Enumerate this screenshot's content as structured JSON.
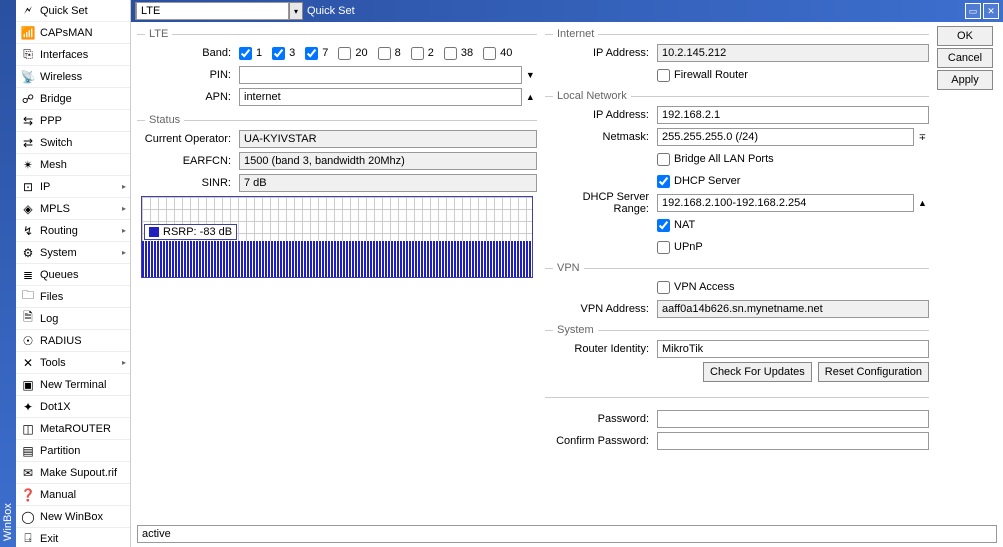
{
  "app_name": "WinBox",
  "sidebar": {
    "items": [
      {
        "label": "Quick Set",
        "icon": "🗲",
        "arrow": false
      },
      {
        "label": "CAPsMAN",
        "icon": "📶",
        "arrow": false
      },
      {
        "label": "Interfaces",
        "icon": "⎘",
        "arrow": false
      },
      {
        "label": "Wireless",
        "icon": "📡",
        "arrow": false
      },
      {
        "label": "Bridge",
        "icon": "☍",
        "arrow": false
      },
      {
        "label": "PPP",
        "icon": "⇆",
        "arrow": false
      },
      {
        "label": "Switch",
        "icon": "⇄",
        "arrow": false
      },
      {
        "label": "Mesh",
        "icon": "✴",
        "arrow": false
      },
      {
        "label": "IP",
        "icon": "⊡",
        "arrow": true
      },
      {
        "label": "MPLS",
        "icon": "◈",
        "arrow": true
      },
      {
        "label": "Routing",
        "icon": "↯",
        "arrow": true
      },
      {
        "label": "System",
        "icon": "⚙",
        "arrow": true
      },
      {
        "label": "Queues",
        "icon": "≣",
        "arrow": false
      },
      {
        "label": "Files",
        "icon": "🗀",
        "arrow": false
      },
      {
        "label": "Log",
        "icon": "🗎",
        "arrow": false
      },
      {
        "label": "RADIUS",
        "icon": "☉",
        "arrow": false
      },
      {
        "label": "Tools",
        "icon": "✕",
        "arrow": true
      },
      {
        "label": "New Terminal",
        "icon": "▣",
        "arrow": false
      },
      {
        "label": "Dot1X",
        "icon": "✦",
        "arrow": false
      },
      {
        "label": "MetaROUTER",
        "icon": "◫",
        "arrow": false
      },
      {
        "label": "Partition",
        "icon": "▤",
        "arrow": false
      },
      {
        "label": "Make Supout.rif",
        "icon": "✉",
        "arrow": false
      },
      {
        "label": "Manual",
        "icon": "❓",
        "arrow": false
      },
      {
        "label": "New WinBox",
        "icon": "◯",
        "arrow": false
      },
      {
        "label": "Exit",
        "icon": "⍈",
        "arrow": false
      }
    ]
  },
  "titlebar": {
    "mode": "LTE",
    "title": "Quick Set"
  },
  "lte": {
    "group_label": "LTE",
    "band_label": "Band:",
    "bands": [
      {
        "num": "1",
        "checked": true
      },
      {
        "num": "3",
        "checked": true
      },
      {
        "num": "7",
        "checked": true
      },
      {
        "num": "20",
        "checked": false
      },
      {
        "num": "8",
        "checked": false
      },
      {
        "num": "2",
        "checked": false
      },
      {
        "num": "38",
        "checked": false
      },
      {
        "num": "40",
        "checked": false
      }
    ],
    "pin_label": "PIN:",
    "pin_value": "",
    "apn_label": "APN:",
    "apn_value": "internet"
  },
  "status": {
    "group_label": "Status",
    "operator_label": "Current Operator:",
    "operator_value": "UA-KYIVSTAR",
    "earfcn_label": "EARFCN:",
    "earfcn_value": "1500 (band 3, bandwidth 20Mhz)",
    "sinr_label": "SINR:",
    "sinr_value": "7 dB",
    "graph_label": "RSRP:  -83 dB",
    "status_text": "active"
  },
  "internet": {
    "group_label": "Internet",
    "ip_label": "IP Address:",
    "ip_value": "10.2.145.212",
    "fw_label": "Firewall Router"
  },
  "lan": {
    "group_label": "Local Network",
    "ip_label": "IP Address:",
    "ip_value": "192.168.2.1",
    "netmask_label": "Netmask:",
    "netmask_value": "255.255.255.0 (/24)",
    "bridge_label": "Bridge All LAN Ports",
    "dhcp_label": "DHCP Server",
    "range_label": "DHCP Server Range:",
    "range_value": "192.168.2.100-192.168.2.254",
    "nat_label": "NAT",
    "upnp_label": "UPnP"
  },
  "vpn": {
    "group_label": "VPN",
    "access_label": "VPN Access",
    "addr_label": "VPN Address:",
    "addr_value": "aaff0a14b626.sn.mynetname.net"
  },
  "system": {
    "group_label": "System",
    "identity_label": "Router Identity:",
    "identity_value": "MikroTik",
    "check_btn": "Check For Updates",
    "reset_btn": "Reset Configuration",
    "pwd_label": "Password:",
    "confirm_label": "Confirm Password:"
  },
  "buttons": {
    "ok": "OK",
    "cancel": "Cancel",
    "apply": "Apply"
  }
}
